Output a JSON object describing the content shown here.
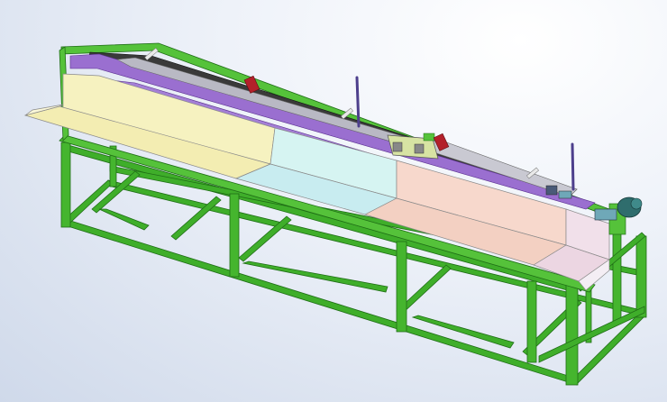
{
  "scene": {
    "subject": "machine-frame-with-trough-conveyor",
    "colors": {
      "background_top": "#ffffff",
      "background_bottom": "#cfd9ea",
      "frame_green": "#3fae2a",
      "frame_green_dark": "#23781a",
      "frame_green_light": "#7fdc5c",
      "trough_yellow": "#f6f2c0",
      "trough_cyan": "#d6f4f2",
      "trough_peach": "#f7d8cc",
      "trough_pink": "#f1e0ea",
      "rail_purple": "#9a6fd0",
      "rail_purple_dark": "#6b3fa3",
      "marker_red": "#b3202a",
      "motor_teal": "#2f6d6d"
    },
    "icons": [
      "drive-motor",
      "indicator-rod",
      "slider-block"
    ]
  }
}
